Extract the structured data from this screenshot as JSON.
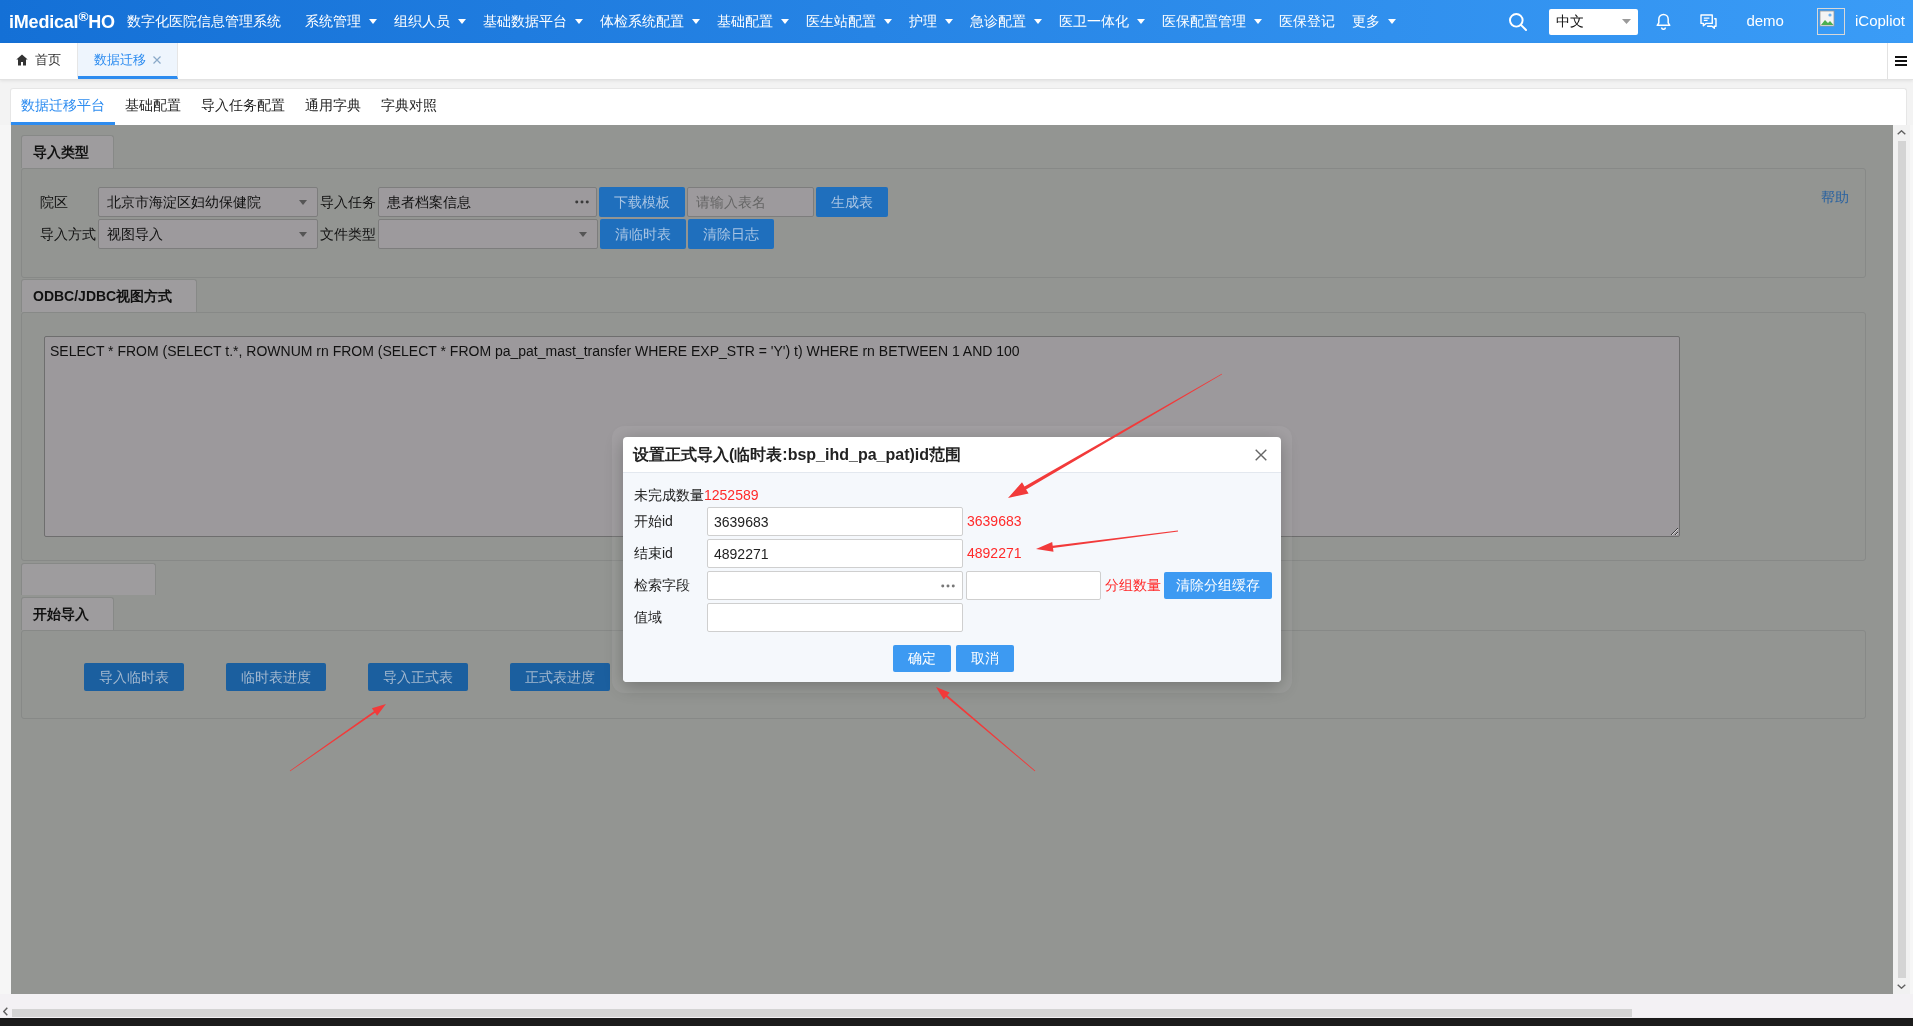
{
  "header": {
    "logo": "iMedical$^{®}$HO",
    "system_name": "数字化医院信息管理系统",
    "menu": [
      {
        "label": "系统管理",
        "dropdown": true
      },
      {
        "label": "组织人员",
        "dropdown": true
      },
      {
        "label": "基础数据平台",
        "dropdown": true
      },
      {
        "label": "体检系统配置",
        "dropdown": true
      },
      {
        "label": "基础配置",
        "dropdown": true
      },
      {
        "label": "医生站配置",
        "dropdown": true
      },
      {
        "label": "护理",
        "dropdown": true
      },
      {
        "label": "急诊配置",
        "dropdown": true
      },
      {
        "label": "医卫一体化",
        "dropdown": true
      },
      {
        "label": "医保配置管理",
        "dropdown": true
      },
      {
        "label": "医保登记",
        "dropdown": false
      },
      {
        "label": "更多",
        "dropdown": true
      }
    ],
    "language_select": {
      "value": "中文"
    },
    "user_name": "demo",
    "assistant_label": "iCopliot"
  },
  "page_tabs": [
    {
      "kind": "home",
      "label": "首页",
      "selected": false,
      "closable": false
    },
    {
      "kind": "page",
      "label": "数据迁移",
      "selected": true,
      "closable": true
    }
  ],
  "sub_tabs": [
    {
      "label": "数据迁移平台",
      "selected": true
    },
    {
      "label": "基础配置",
      "selected": false
    },
    {
      "label": "导入任务配置",
      "selected": false
    },
    {
      "label": "通用字典",
      "selected": false
    },
    {
      "label": "字典对照",
      "selected": false
    }
  ],
  "panels": [
    {
      "kind": "form",
      "title": "导入类型",
      "help_link": "帮助",
      "rows": [
        {
          "items": [
            {
              "kind": "label",
              "text": "院区"
            },
            {
              "kind": "select",
              "value": "北京市海淀区妇幼保健院"
            },
            {
              "kind": "label",
              "text": "导入任务"
            },
            {
              "kind": "lookup",
              "value": "患者档案信息"
            },
            {
              "kind": "button",
              "label": "下载模板"
            },
            {
              "kind": "input",
              "placeholder": "请输入表名"
            },
            {
              "kind": "button",
              "label": "生成表"
            }
          ]
        },
        {
          "items": [
            {
              "kind": "label",
              "text": "导入方式"
            },
            {
              "kind": "select",
              "value": "视图导入"
            },
            {
              "kind": "label",
              "text": "文件类型"
            },
            {
              "kind": "select"
            },
            {
              "kind": "button",
              "label": "清临时表"
            },
            {
              "kind": "button",
              "label": "清除日志"
            }
          ]
        }
      ]
    },
    {
      "kind": "query",
      "title": "ODBC/JDBC视图方式",
      "query": "SELECT * FROM (SELECT t.*, ROWNUM rn FROM (SELECT * FROM pa_pat_mast_transfer WHERE EXP_STR = 'Y') t) WHERE rn BETWEEN 1 AND 100"
    },
    {
      "kind": "blank"
    },
    {
      "kind": "actions",
      "title": "开始导入",
      "buttons": [
        {
          "label": "导入临时表"
        },
        {
          "label": "临时表进度"
        },
        {
          "label": "导入正式表"
        },
        {
          "label": "正式表进度"
        }
      ]
    }
  ],
  "dialog": {
    "title": "设置正式导入(临时表:bsp_ihd_pa_pat)id范围",
    "summary": {
      "label": "未完成数量",
      "value": "1252589"
    },
    "rows": [
      {
        "label": "开始id",
        "items": [
          {
            "kind": "input",
            "value": "3639683"
          },
          {
            "kind": "note",
            "text": "3639683"
          }
        ]
      },
      {
        "label": "结束id",
        "items": [
          {
            "kind": "input",
            "value": "4892271"
          },
          {
            "kind": "note",
            "text": "4892271"
          }
        ]
      },
      {
        "label": "检索字段",
        "items": [
          {
            "kind": "lookup"
          },
          {
            "kind": "short_input"
          },
          {
            "kind": "note",
            "text": "分组数量"
          },
          {
            "kind": "button",
            "label": "清除分组缓存"
          }
        ]
      },
      {
        "label": "值域",
        "items": [
          {
            "kind": "input"
          }
        ]
      }
    ],
    "buttons": [
      {
        "label": "确定"
      },
      {
        "label": "取消"
      }
    ]
  }
}
